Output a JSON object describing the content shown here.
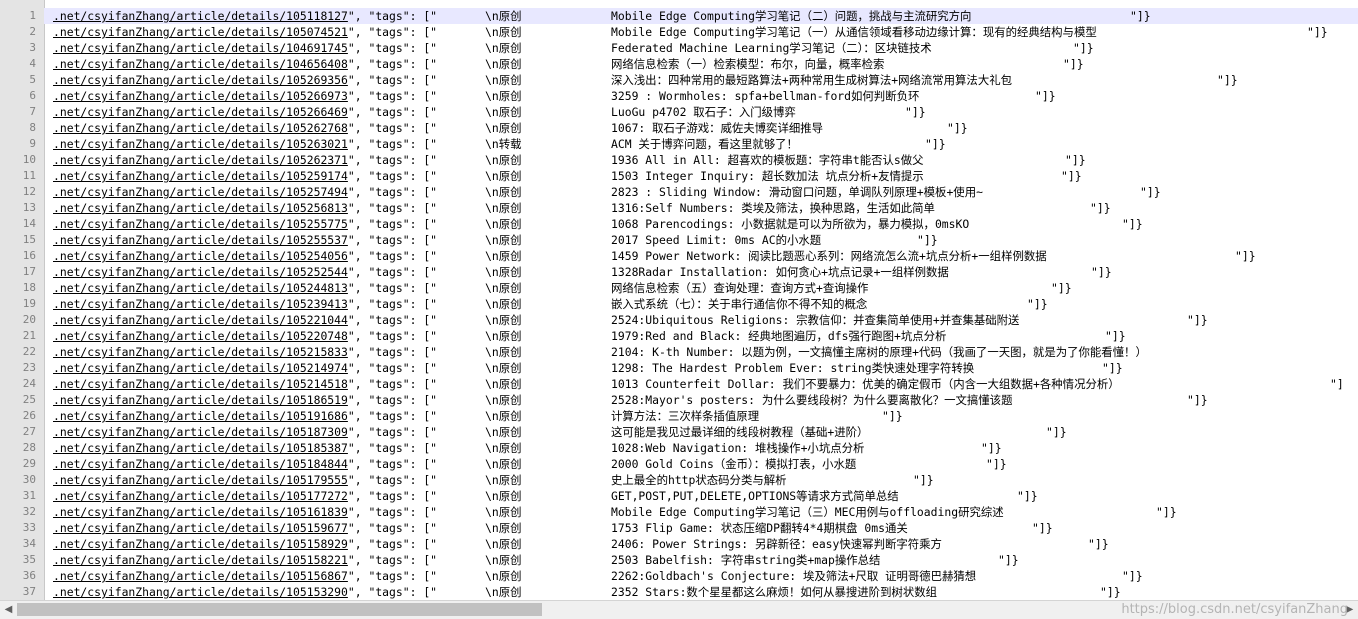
{
  "editor": {
    "lines": [
      {
        "num": "1",
        "url": ".net/csyifanZhang/article/details/105118127",
        "tag": "\\n原创",
        "title": "Mobile Edge Computing学习笔记（二）问题，挑战与主流研究方向",
        "end": "\"]}"
      },
      {
        "num": "2",
        "url": ".net/csyifanZhang/article/details/105074521",
        "tag": "\\n原创",
        "title": "Mobile Edge Computing学习笔记（一）从通信领域看移动边缘计算：现有的经典结构与模型",
        "end": "\"]}"
      },
      {
        "num": "3",
        "url": ".net/csyifanZhang/article/details/104691745",
        "tag": "\\n原创",
        "title": "Federated Machine Learning学习笔记（二）：区块链技术",
        "end": "\"]}"
      },
      {
        "num": "4",
        "url": ".net/csyifanZhang/article/details/104656408",
        "tag": "\\n原创",
        "title": "网络信息检索（一）检索模型：布尔，向量，概率检索",
        "end": "\"]}"
      },
      {
        "num": "5",
        "url": ".net/csyifanZhang/article/details/105269356",
        "tag": "\\n原创",
        "title": "深入浅出：四种常用的最短路算法+两种常用生成树算法+网络流常用算法大礼包",
        "end": "\"]}"
      },
      {
        "num": "6",
        "url": ".net/csyifanZhang/article/details/105266973",
        "tag": "\\n原创",
        "title": "3259 : Wormholes: spfa+bellman-ford如何判断负环",
        "end": "\"]}"
      },
      {
        "num": "7",
        "url": ".net/csyifanZhang/article/details/105266469",
        "tag": "\\n原创",
        "title": "LuoGu p4702 取石子：入门级博弈",
        "end": "\"]}"
      },
      {
        "num": "8",
        "url": ".net/csyifanZhang/article/details/105262768",
        "tag": "\\n原创",
        "title": "1067: 取石子游戏：威佐夫博奕详细推导",
        "end": "\"]}"
      },
      {
        "num": "9",
        "url": ".net/csyifanZhang/article/details/105263021",
        "tag": "\\n转载",
        "title": "ACM 关于博弈问题，看这里就够了！",
        "end": "\"]}"
      },
      {
        "num": "10",
        "url": ".net/csyifanZhang/article/details/105262371",
        "tag": "\\n原创",
        "title": "1936 All in All: 超喜欢的模板题：字符串t能否认s做父",
        "end": "\"]}"
      },
      {
        "num": "11",
        "url": ".net/csyifanZhang/article/details/105259174",
        "tag": "\\n原创",
        "title": "1503 Integer Inquiry: 超长数加法 坑点分析+友情提示",
        "end": "\"]}"
      },
      {
        "num": "12",
        "url": ".net/csyifanZhang/article/details/105257494",
        "tag": "\\n原创",
        "title": "2823 : Sliding Window: 滑动窗口问题，单调队列原理+模板+使用~",
        "end": "\"]}"
      },
      {
        "num": "13",
        "url": ".net/csyifanZhang/article/details/105256813",
        "tag": "\\n原创",
        "title": "1316:Self Numbers: 类埃及筛法，换种思路，生活如此简单",
        "end": "\"]}"
      },
      {
        "num": "14",
        "url": ".net/csyifanZhang/article/details/105255775",
        "tag": "\\n原创",
        "title": "1068 Parencodings: 小数据就是可以为所欲为，暴力模拟，0msKO",
        "end": "\"]}"
      },
      {
        "num": "15",
        "url": ".net/csyifanZhang/article/details/105255537",
        "tag": "\\n原创",
        "title": "2017 Speed Limit: 0ms AC的小水题",
        "end": "\"]}"
      },
      {
        "num": "16",
        "url": ".net/csyifanZhang/article/details/105254056",
        "tag": "\\n原创",
        "title": "1459 Power Network: 阅读比题恶心系列：网络流怎么流+坑点分析+一组样例数据",
        "end": "\"]}"
      },
      {
        "num": "17",
        "url": ".net/csyifanZhang/article/details/105252544",
        "tag": "\\n原创",
        "title": "1328Radar Installation: 如何贪心+坑点记录+一组样例数据",
        "end": "\"]}"
      },
      {
        "num": "18",
        "url": ".net/csyifanZhang/article/details/105244813",
        "tag": "\\n原创",
        "title": "网络信息检索（五）查询处理：查询方式+查询操作",
        "end": "\"]}"
      },
      {
        "num": "19",
        "url": ".net/csyifanZhang/article/details/105239413",
        "tag": "\\n原创",
        "title": "嵌入式系统（七）：关于串行通信你不得不知的概念",
        "end": "\"]}"
      },
      {
        "num": "20",
        "url": ".net/csyifanZhang/article/details/105221044",
        "tag": "\\n原创",
        "title": "2524:Ubiquitous Religions: 宗教信仰：并查集简单使用+并查集基础附送",
        "end": "\"]}"
      },
      {
        "num": "21",
        "url": ".net/csyifanZhang/article/details/105220748",
        "tag": "\\n原创",
        "title": "1979:Red and Black: 经典地图遍历，dfs强行跑图+坑点分析",
        "end": "\"]}"
      },
      {
        "num": "22",
        "url": ".net/csyifanZhang/article/details/105215833",
        "tag": "\\n原创",
        "title": "2104: K-th Number: 以题为例，一文搞懂主席树的原理+代码（我画了一天图，就是为了你能看懂！）",
        "end": ""
      },
      {
        "num": "23",
        "url": ".net/csyifanZhang/article/details/105214974",
        "tag": "\\n原创",
        "title": "1298: The Hardest Problem Ever: string类快速处理字符转换",
        "end": "\"]}"
      },
      {
        "num": "24",
        "url": ".net/csyifanZhang/article/details/105214518",
        "tag": "\\n原创",
        "title": "1013 Counterfeit Dollar: 我们不要暴力：优美的确定假币（内含一大组数据+各种情况分析）",
        "end": "\"]"
      },
      {
        "num": "25",
        "url": ".net/csyifanZhang/article/details/105186519",
        "tag": "\\n原创",
        "title": "2528:Mayor's posters: 为什么要线段树？为什么要离散化？一文搞懂该题",
        "end": "\"]}"
      },
      {
        "num": "26",
        "url": ".net/csyifanZhang/article/details/105191686",
        "tag": "\\n原创",
        "title": "计算方法：三次样条插值原理",
        "end": "\"]}"
      },
      {
        "num": "27",
        "url": ".net/csyifanZhang/article/details/105187309",
        "tag": "\\n原创",
        "title": "这可能是我见过最详细的线段树教程（基础+进阶）",
        "end": "\"]}"
      },
      {
        "num": "28",
        "url": ".net/csyifanZhang/article/details/105185387",
        "tag": "\\n原创",
        "title": "1028:Web Navigation: 堆栈操作+小坑点分析",
        "end": "\"]}"
      },
      {
        "num": "29",
        "url": ".net/csyifanZhang/article/details/105184844",
        "tag": "\\n原创",
        "title": "2000 Gold Coins（金币）：模拟打表，小水题",
        "end": "\"]}"
      },
      {
        "num": "30",
        "url": ".net/csyifanZhang/article/details/105179555",
        "tag": "\\n原创",
        "title": "史上最全的http状态码分类与解析",
        "end": "\"]}"
      },
      {
        "num": "31",
        "url": ".net/csyifanZhang/article/details/105177272",
        "tag": "\\n原创",
        "title": "GET,POST,PUT,DELETE,OPTIONS等请求方式简单总结",
        "end": "\"]}"
      },
      {
        "num": "32",
        "url": ".net/csyifanZhang/article/details/105161839",
        "tag": "\\n原创",
        "title": "Mobile Edge Computing学习笔记（三）MEC用例与offloading研究综述",
        "end": "\"]}"
      },
      {
        "num": "33",
        "url": ".net/csyifanZhang/article/details/105159677",
        "tag": "\\n原创",
        "title": "1753 Flip Game: 状态压缩DP翻转4*4期棋盘 0ms通关",
        "end": "\"]}"
      },
      {
        "num": "34",
        "url": ".net/csyifanZhang/article/details/105158929",
        "tag": "\\n原创",
        "title": "2406: Power Strings: 另辟新径：easy快速幂判断字符乘方",
        "end": "\"]}"
      },
      {
        "num": "35",
        "url": ".net/csyifanZhang/article/details/105158221",
        "tag": "\\n原创",
        "title": "2503 Babelfish: 字符串string类+map操作总结",
        "end": "\"]}"
      },
      {
        "num": "36",
        "url": ".net/csyifanZhang/article/details/105156867",
        "tag": "\\n原创",
        "title": "2262:Goldbach's Conjecture: 埃及筛法+尺取 证明哥德巴赫猜想",
        "end": "\"]}"
      },
      {
        "num": "37",
        "url": ".net/csyifanZhang/article/details/105153290",
        "tag": "\\n原创",
        "title": "2352 Stars:数个星星都这么麻烦！如何从暴搜进阶到树状数组",
        "end": "\"]}"
      }
    ],
    "middle_text": "\", \"tags\": [\""
  },
  "end_offsets": [
    1130,
    1307,
    1073,
    1063,
    1217,
    1035,
    905,
    947,
    925,
    1065,
    1061,
    1140,
    1090,
    1122,
    917,
    1235,
    1091,
    1051,
    1027,
    1187,
    1105,
    0,
    1102,
    1330,
    1187,
    882,
    1046,
    981,
    986,
    913,
    1017,
    1156,
    1032,
    1088,
    998,
    1122,
    1100
  ],
  "watermark": "https://blog.csdn.net/csyifanZhang",
  "scrollbar": {
    "left_arrow": "◀",
    "right_arrow": "▶"
  }
}
